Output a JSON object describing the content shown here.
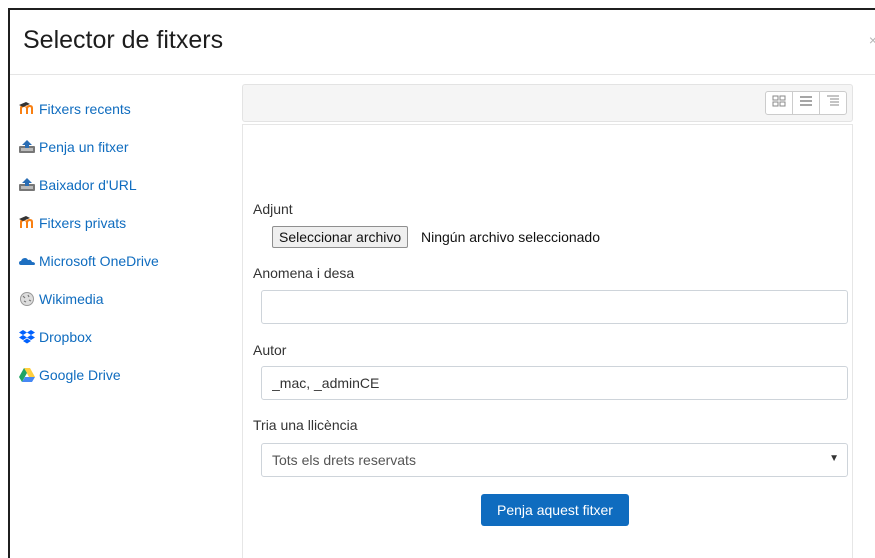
{
  "dialog": {
    "title": "Selector de fitxers",
    "close_label": "×"
  },
  "sidebar": {
    "items": [
      {
        "label": "Fitxers recents",
        "icon": "moodle-icon"
      },
      {
        "label": "Penja un fitxer",
        "icon": "upload-icon"
      },
      {
        "label": "Baixador d'URL",
        "icon": "url-download-icon"
      },
      {
        "label": "Fitxers privats",
        "icon": "moodle-icon"
      },
      {
        "label": "Microsoft OneDrive",
        "icon": "onedrive-icon"
      },
      {
        "label": "Wikimedia",
        "icon": "wikimedia-icon"
      },
      {
        "label": "Dropbox",
        "icon": "dropbox-icon"
      },
      {
        "label": "Google Drive",
        "icon": "google-drive-icon"
      }
    ]
  },
  "toolbar": {
    "views": [
      "icon-view",
      "list-view",
      "tree-view"
    ]
  },
  "form": {
    "attachment_label": "Adjunt",
    "file_button": "Seleccionar archivo",
    "file_status": "Ningún archivo seleccionado",
    "save_as_label": "Anomena i desa",
    "save_as_value": "",
    "author_label": "Autor",
    "author_value": "_mac, _adminCE",
    "license_label": "Tria una llicència",
    "license_value": "Tots els drets reservats",
    "submit_label": "Penja aquest fitxer"
  },
  "colors": {
    "accent": "#0f6cbf",
    "moodle_orange": "#f98012"
  }
}
